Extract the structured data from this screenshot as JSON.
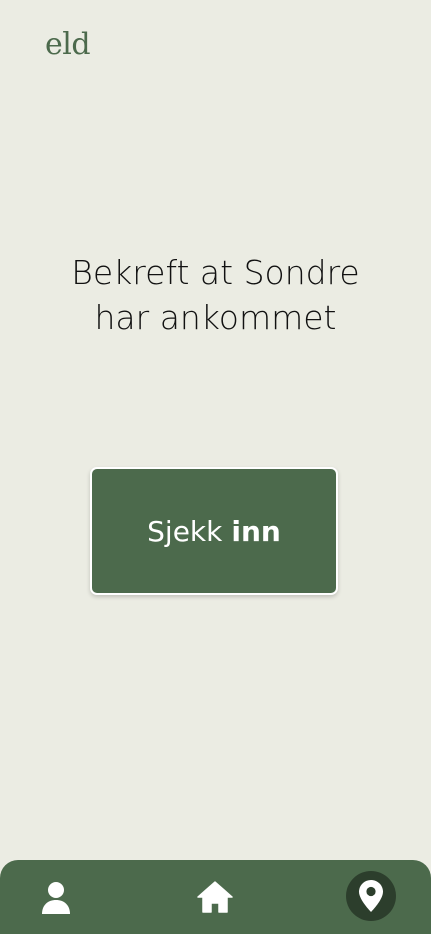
{
  "app": {
    "logo_text": "eld"
  },
  "main": {
    "headline_line1": "Bekreft at Sondre",
    "headline_line2": "har ankommet",
    "checkin_button": {
      "label_regular": "Sjekk",
      "label_bold": "inn"
    }
  },
  "bottom_nav": {
    "items": [
      {
        "icon": "person-icon",
        "active": false
      },
      {
        "icon": "home-icon",
        "active": false
      },
      {
        "icon": "location-pin-icon",
        "active": true
      }
    ]
  },
  "colors": {
    "background": "#ebece3",
    "accent_green": "#4c6a4c",
    "active_nav_circle": "#2c3e2c",
    "text": "#111111"
  }
}
